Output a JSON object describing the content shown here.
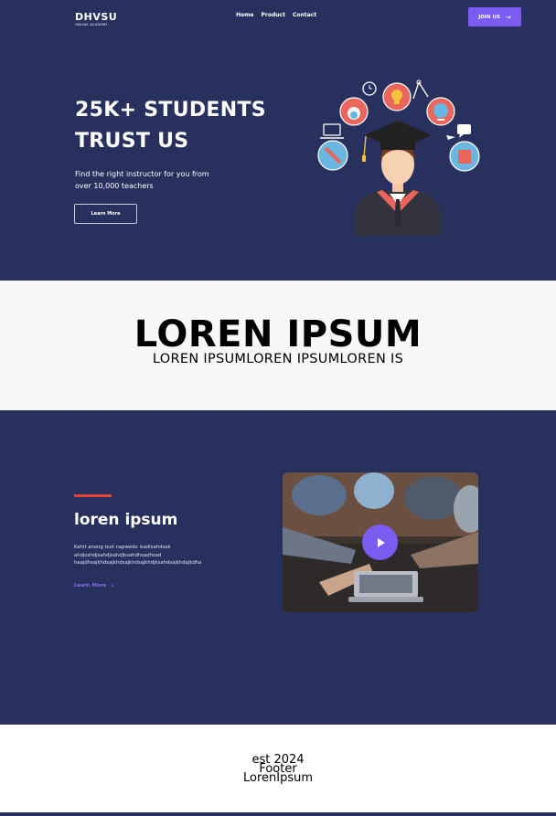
{
  "brand": {
    "name": "DHVSU",
    "tagline": "ONLINE ACADEMY"
  },
  "nav": {
    "items": [
      "Home",
      "Product",
      "Contact"
    ]
  },
  "join_button": {
    "label": "JOIN US",
    "icon": "arrow-right-icon"
  },
  "hero": {
    "title_line1": "25K+ STUDENTS",
    "title_line2": "TRUST US",
    "subtitle_line1": "Find the right instructor for you from",
    "subtitle_line2": "over 10,000 teachers",
    "button_label": "Learn More"
  },
  "band": {
    "title": "LOREN IPSUM",
    "subtitle": "LOREN IPSUMLOREN IPSUMLOREN IS"
  },
  "feature": {
    "title": "loren ipsum",
    "text_line1": "Kahit anong text napwede isadlsahdsak",
    "text_line2": "ahdjsahdjsahdjsahdjksahdhsadhsad",
    "text_line3": "haajdhsajkhdsajkhdsajkhdsajkhdjksahdsajkhdajkdha",
    "link_label": "Learn More",
    "link_icon": "chevron-right-icon",
    "video_icon": "play-icon"
  },
  "footer": {
    "line1": "est 2024",
    "line2": "Footer",
    "line3": "LorenIpsum"
  },
  "colors": {
    "navy": "#28315e",
    "accent": "#7b5cf0",
    "red": "#e4433d",
    "light": "#f7f7f7"
  }
}
